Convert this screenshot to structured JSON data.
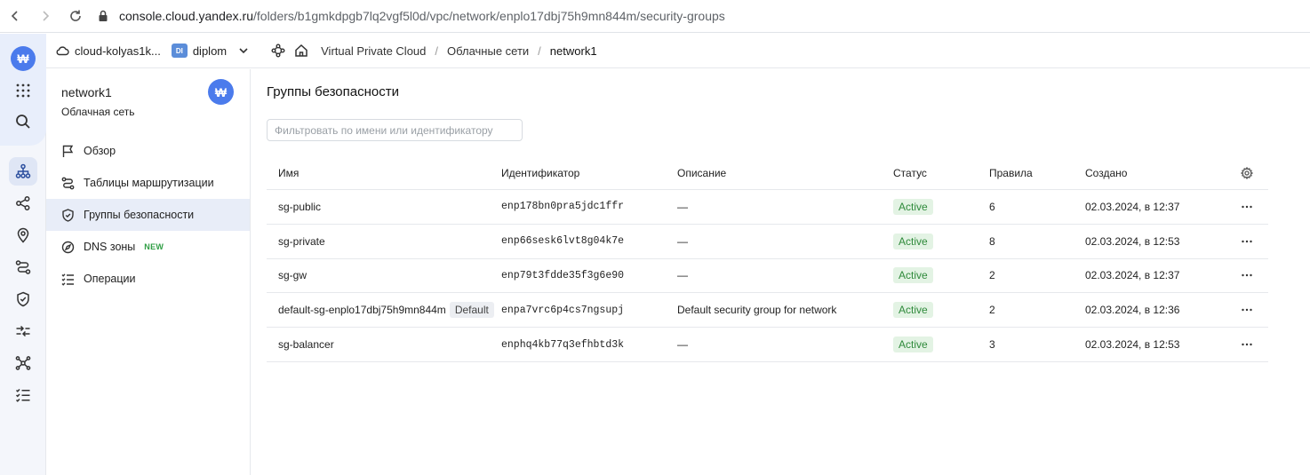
{
  "browser": {
    "url_domain": "console.cloud.yandex.ru",
    "url_path": "/folders/b1gmkdpgb7lq2vgf5l0d/vpc/network/enplo17dbj75h9mn844m/security-groups"
  },
  "rail": {
    "avatar_letter": "₩"
  },
  "header": {
    "cloud_name": "cloud-kolyas1k...",
    "folder_badge": "DI",
    "folder_name": "diplom",
    "crumbs": [
      "Virtual Private Cloud",
      "Облачные сети",
      "network1"
    ],
    "separator": "/"
  },
  "sidebar": {
    "title": "network1",
    "subtitle": "Облачная сеть",
    "avatar_letter": "₩",
    "items": [
      {
        "label": "Обзор"
      },
      {
        "label": "Таблицы маршрутизации"
      },
      {
        "label": "Группы безопасности"
      },
      {
        "label": "DNS зоны",
        "badge": "NEW"
      },
      {
        "label": "Операции"
      }
    ]
  },
  "main": {
    "title": "Группы безопасности",
    "filter_placeholder": "Фильтровать по имени или идентификатору",
    "columns": {
      "name": "Имя",
      "id": "Идентификатор",
      "desc": "Описание",
      "status": "Статус",
      "rules": "Правила",
      "created": "Создано"
    },
    "rows": [
      {
        "name": "sg-public",
        "default": "",
        "id": "enp178bn0pra5jdc1ffr",
        "desc": "—",
        "status": "Active",
        "rules": "6",
        "created": "02.03.2024, в 12:37"
      },
      {
        "name": "sg-private",
        "default": "",
        "id": "enp66sesk6lvt8g04k7e",
        "desc": "—",
        "status": "Active",
        "rules": "8",
        "created": "02.03.2024, в 12:53"
      },
      {
        "name": "sg-gw",
        "default": "",
        "id": "enp79t3fdde35f3g6e90",
        "desc": "—",
        "status": "Active",
        "rules": "2",
        "created": "02.03.2024, в 12:37"
      },
      {
        "name": "default-sg-enplo17dbj75h9mn844m",
        "default": "Default",
        "id": "enpa7vrc6p4cs7ngsupj",
        "desc": "Default security group for network",
        "status": "Active",
        "rules": "2",
        "created": "02.03.2024, в 12:36"
      },
      {
        "name": "sg-balancer",
        "default": "",
        "id": "enphq4kb77q3efhbtd3k",
        "desc": "—",
        "status": "Active",
        "rules": "3",
        "created": "02.03.2024, в 12:53"
      }
    ]
  }
}
